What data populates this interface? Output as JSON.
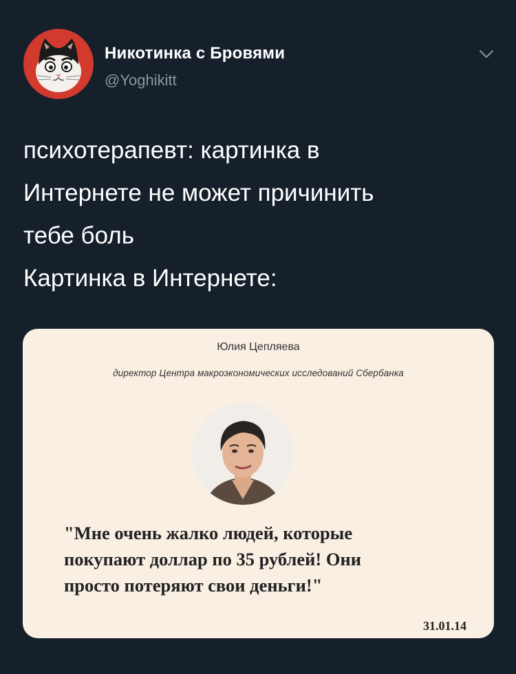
{
  "author": {
    "display_name": "Никотинка с Бровями",
    "handle": "@Yoghikitt",
    "avatar_icon": "cat-avatar-icon",
    "avatar_bg": "#d23a2e"
  },
  "tweet": {
    "text": "психотерапевт: картинка в\nИнтернете не может причинить\nтебе боль\nКартинка в Интернете:"
  },
  "media": {
    "name": "Юлия Цепляева",
    "role": "директор Центра макроэкономических исследований Сбербанка",
    "quote": "\"Мне очень жалко людей, которые\nпокупают доллар по 35 рублей! Они\nпросто потеряют свои деньги!\"",
    "date": "31.01.14",
    "background": "#f9efe3"
  },
  "colors": {
    "background": "#15202b",
    "text_primary": "#ffffff",
    "text_secondary": "#8899a6"
  }
}
